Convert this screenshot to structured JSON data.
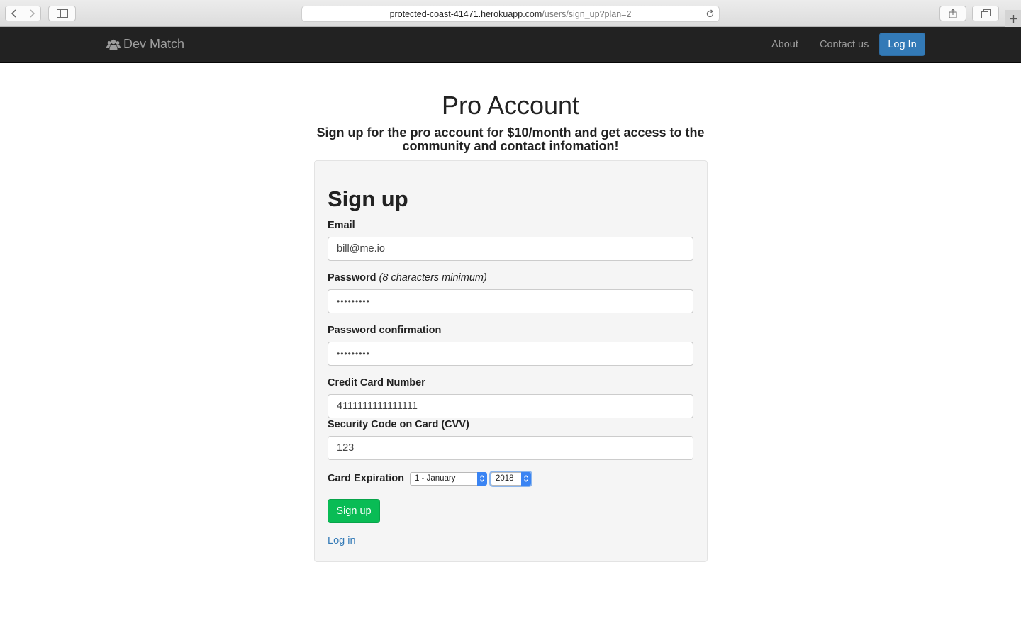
{
  "browser": {
    "url_host": "protected-coast-41471.herokuapp.com",
    "url_path": "/users/sign_up?plan=2"
  },
  "navbar": {
    "brand": "Dev Match",
    "links": [
      "About",
      "Contact us"
    ],
    "login_button": "Log In"
  },
  "page": {
    "title": "Pro Account",
    "subtitle": "Sign up for the pro account for $10/month and get access to the community and contact infomation!"
  },
  "form": {
    "title": "Sign up",
    "email_label": "Email",
    "email_value": "bill@me.io",
    "password_label": "Password",
    "password_hint": "(8 characters minimum)",
    "password_value": "•••••••••",
    "password_confirmation_label": "Password confirmation",
    "password_confirmation_value": "•••••••••",
    "card_number_label": "Credit Card Number",
    "card_number_value": "4111111111111111",
    "cvv_label": "Security Code on Card (CVV)",
    "cvv_value": "123",
    "expiration_label": "Card Expiration",
    "expiration_month": "1 - January",
    "expiration_year": "2018",
    "submit_label": "Sign up",
    "login_link": "Log in"
  },
  "colors": {
    "navbar_bg": "#222222",
    "primary": "#337ab7",
    "success": "#09bc55"
  }
}
